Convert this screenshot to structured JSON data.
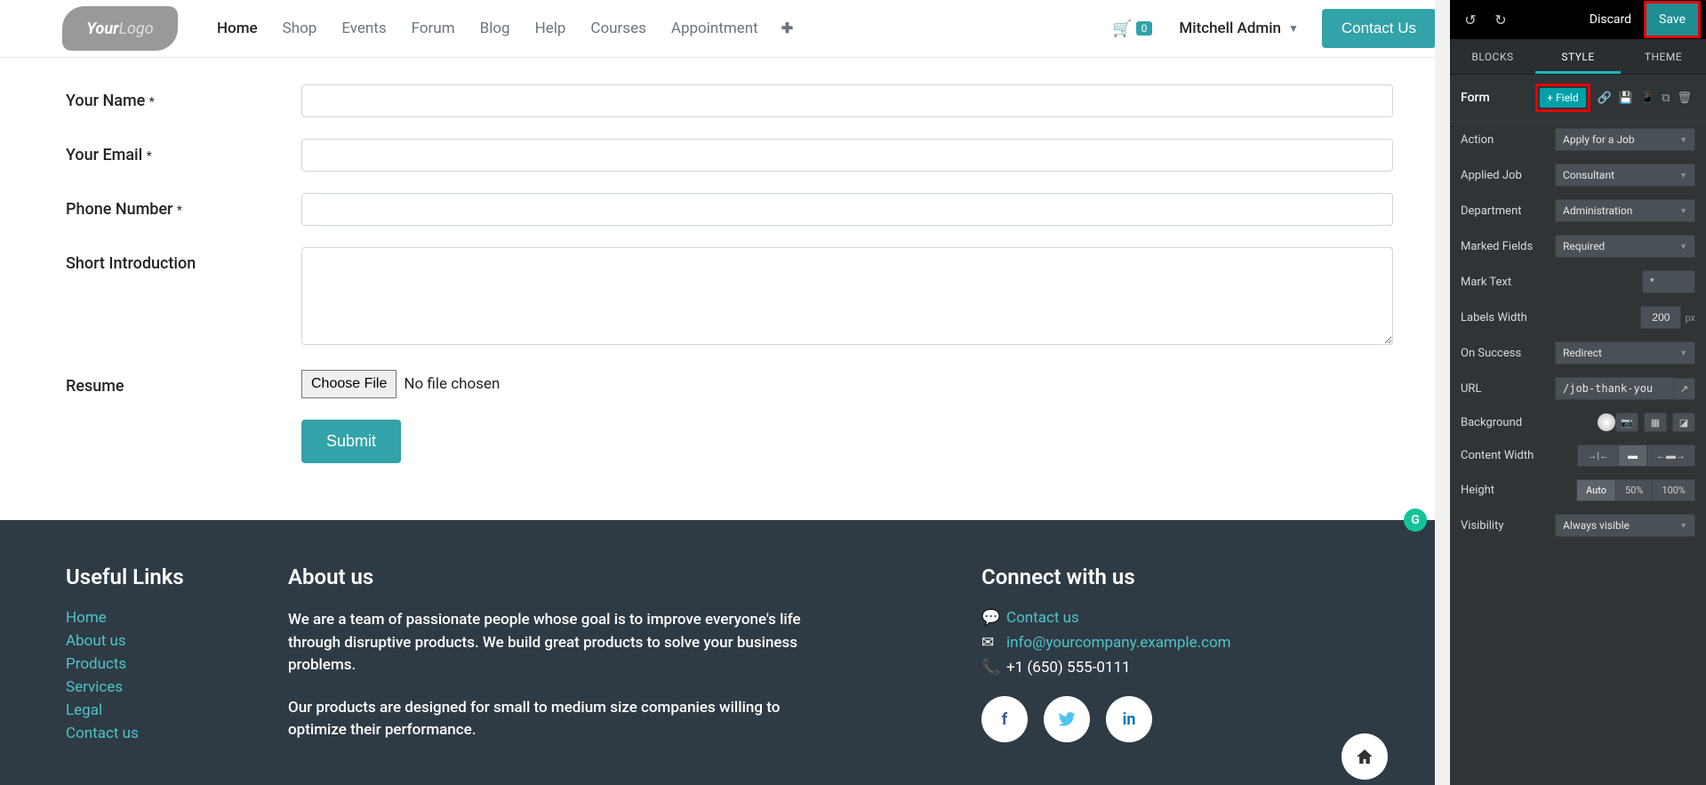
{
  "nav": {
    "logo_part1": "Your",
    "logo_part2": "Logo",
    "items": [
      "Home",
      "Shop",
      "Events",
      "Forum",
      "Blog",
      "Help",
      "Courses",
      "Appointment"
    ],
    "cart_count": "0",
    "user": "Mitchell Admin",
    "contact_btn": "Contact Us"
  },
  "form": {
    "fields": {
      "name": {
        "label": "Your Name",
        "req": "*"
      },
      "email": {
        "label": "Your Email",
        "req": "*"
      },
      "phone": {
        "label": "Phone Number",
        "req": "*"
      },
      "intro": {
        "label": "Short Introduction"
      },
      "resume": {
        "label": "Resume",
        "choose": "Choose File",
        "nofile": "No file chosen"
      }
    },
    "submit": "Submit"
  },
  "footer": {
    "useful_title": "Useful Links",
    "useful_links": [
      "Home",
      "About us",
      "Products",
      "Services",
      "Legal",
      "Contact us"
    ],
    "about_title": "About us",
    "about_p1": "We are a team of passionate people whose goal is to improve everyone's life through disruptive products. We build great products to solve your business problems.",
    "about_p2": "Our products are designed for small to medium size companies willing to optimize their performance.",
    "connect_title": "Connect with us",
    "contact_link": "Contact us",
    "email": "info@yourcompany.example.com",
    "phone": "+1 (650) 555-0111"
  },
  "editor": {
    "discard": "Discard",
    "save": "Save",
    "tabs": [
      "BLOCKS",
      "STYLE",
      "THEME"
    ],
    "section_title": "Form",
    "field_btn": "+ Field",
    "rows": {
      "action": {
        "label": "Action",
        "value": "Apply for a Job"
      },
      "applied_job": {
        "label": "Applied Job",
        "value": "Consultant"
      },
      "department": {
        "label": "Department",
        "value": "Administration"
      },
      "marked_fields": {
        "label": "Marked Fields",
        "value": "Required"
      },
      "mark_text": {
        "label": "Mark Text",
        "value": "*"
      },
      "labels_width": {
        "label": "Labels Width",
        "value": "200",
        "unit": "px"
      },
      "on_success": {
        "label": "On Success",
        "value": "Redirect"
      },
      "url": {
        "label": "URL",
        "value": "/job-thank-you"
      },
      "background": {
        "label": "Background"
      },
      "content_width": {
        "label": "Content Width"
      },
      "height": {
        "label": "Height",
        "opts": [
          "Auto",
          "50%",
          "100%"
        ]
      },
      "visibility": {
        "label": "Visibility",
        "value": "Always visible"
      }
    }
  }
}
